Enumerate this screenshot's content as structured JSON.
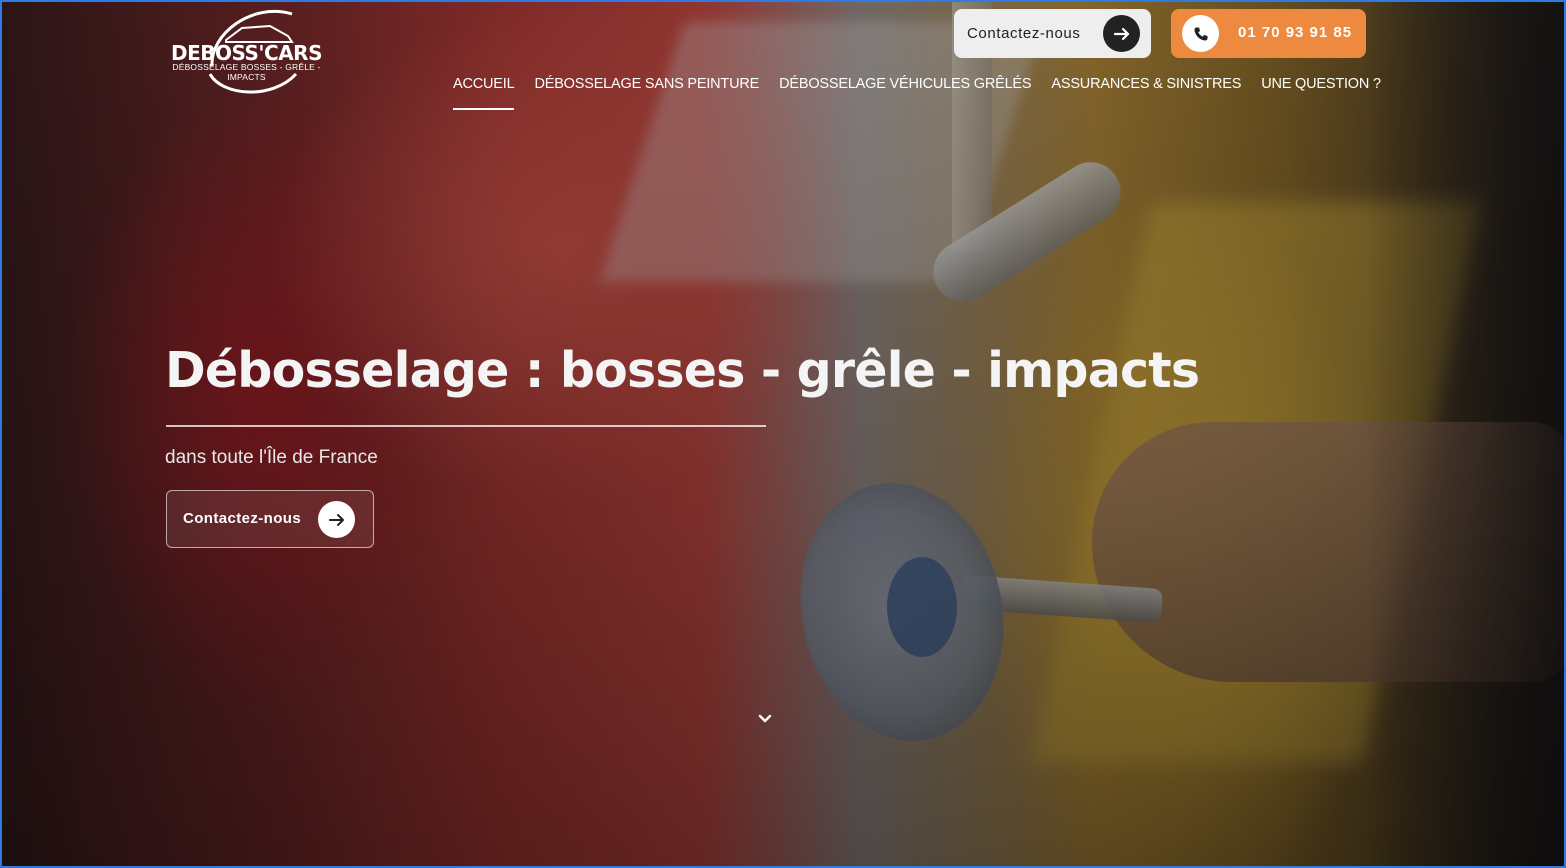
{
  "brand": {
    "name": "DEBOSS'CARS",
    "tagline": "DÉBOSSELAGE BOSSES - GRÊLE - IMPACTS"
  },
  "header": {
    "contact_button_label": "Contactez-nous",
    "phone_number": "01 70 93 91 85"
  },
  "nav": {
    "items": [
      {
        "label": "ACCUEIL",
        "active": true
      },
      {
        "label": "DÉBOSSELAGE SANS PEINTURE",
        "active": false
      },
      {
        "label": "DÉBOSSELAGE VÉHICULES GRÊLÉS",
        "active": false
      },
      {
        "label": "ASSURANCES & SINISTRES",
        "active": false
      },
      {
        "label": "UNE QUESTION ?",
        "active": false
      }
    ]
  },
  "hero": {
    "title": "Débosselage : bosses - grêle - impacts",
    "subtitle": "dans toute l'Île de France",
    "cta_label": "Contactez-nous"
  },
  "icons": {
    "arrow": "arrow-right-icon",
    "phone": "phone-icon",
    "scroll": "chevron-down-icon",
    "logo": "car-outline-logo"
  },
  "colors": {
    "accent_orange": "#ee8a40",
    "button_light": "#eeeeee",
    "button_dark_circle": "#222222",
    "text_white": "#ffffff"
  }
}
